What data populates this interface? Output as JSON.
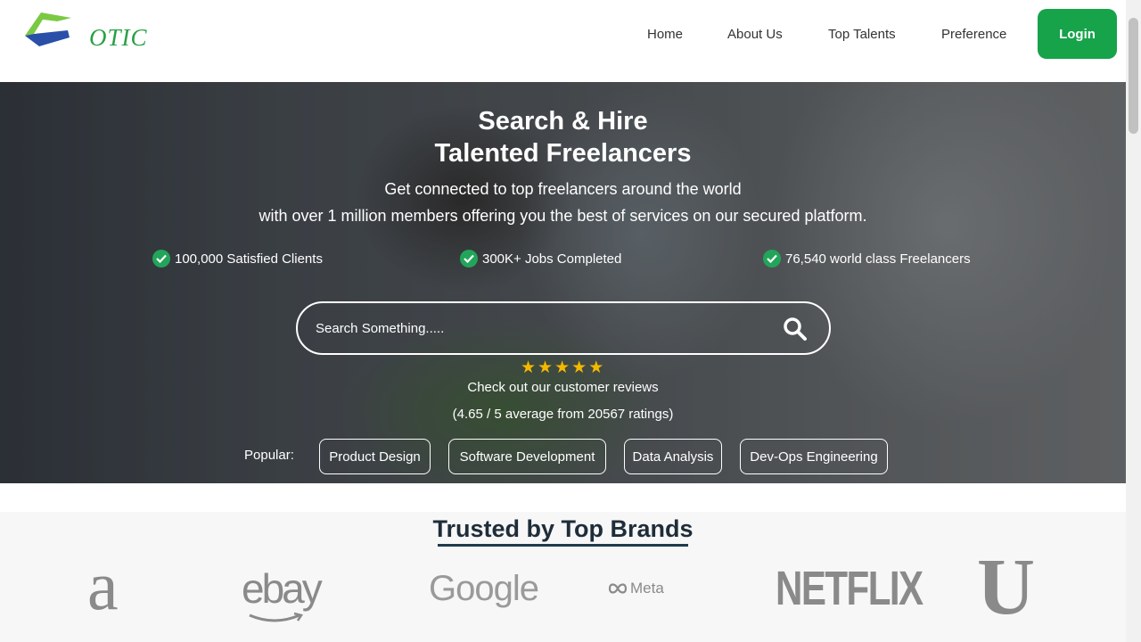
{
  "brand": {
    "logo_text": "OTIC"
  },
  "nav": {
    "items": [
      "Home",
      "About Us",
      "Top Talents",
      "Preference"
    ],
    "login_label": "Login"
  },
  "hero": {
    "title_line1": "Search & Hire",
    "title_line2": "Talented Freelancers",
    "subtitle_line1": "Get connected to top freelancers around the world",
    "subtitle_line2": "with over 1 million members offering you the best of services on our secured platform.",
    "stats": [
      "100,000 Satisfied Clients",
      "300K+ Jobs Completed",
      "76,540 world class Freelancers"
    ],
    "search": {
      "placeholder": "Search Something....."
    },
    "rating_stars": 5,
    "reviews_text": "Check out our customer reviews",
    "rating_text": "(4.65 / 5 average from 20567 ratings)",
    "popular_label": "Popular:",
    "popular_tags": [
      "Product Design",
      "Software Development",
      "Data Analysis",
      "Dev-Ops Engineering"
    ]
  },
  "brands_section": {
    "title": "Trusted by Top Brands",
    "brands": [
      "a",
      "ebay",
      "Google",
      "Meta",
      "NETFLIX",
      "U"
    ]
  },
  "colors": {
    "accent": "#16a34a",
    "check": "#22a55a",
    "star": "#f5b800",
    "heading": "#1f2d3a"
  }
}
